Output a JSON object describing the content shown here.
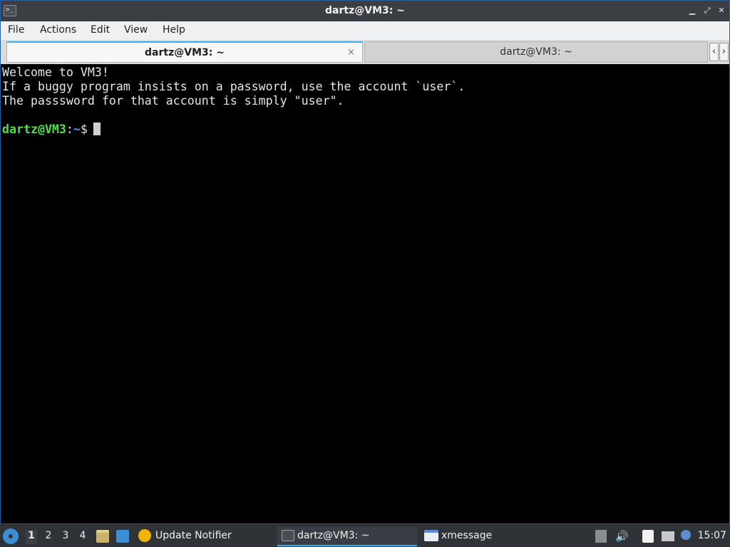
{
  "window": {
    "title": "dartz@VM3: ~",
    "icon": "terminal-icon",
    "buttons": {
      "minimize": "▁",
      "restore": "⤢",
      "close": "✕"
    }
  },
  "menu": {
    "items": [
      "File",
      "Actions",
      "Edit",
      "View",
      "Help"
    ]
  },
  "tabs": [
    {
      "label": "dartz@VM3: ~",
      "active": true,
      "close": "×"
    },
    {
      "label": "dartz@VM3: ~",
      "active": false
    }
  ],
  "tab_scroll": {
    "left": "‹",
    "right": "›"
  },
  "terminal": {
    "lines": [
      "Welcome to VM3!",
      "If a buggy program insists on a password, use the account `user`.",
      "The passsword for that account is simply \"user\"."
    ],
    "prompt": {
      "user_host": "dartz@VM3",
      "separator": ":",
      "path": "~",
      "symbol": "$"
    },
    "colors": {
      "background": "#000000",
      "text": "#e5e5e5",
      "user": "#4fe04a",
      "path": "#6e8ef5"
    }
  },
  "taskbar": {
    "start_icon": "kde-start-icon",
    "desktops": [
      "1",
      "2",
      "3",
      "4"
    ],
    "current_desktop": "1",
    "launchers": [
      "file-manager-icon",
      "show-desktop-icon"
    ],
    "tasks": [
      {
        "label": "Update Notifier",
        "icon": "update-notifier-icon",
        "active": false
      },
      {
        "label": "dartz@VM3: ~",
        "icon": "terminal-icon",
        "active": true
      },
      {
        "label": "xmessage",
        "icon": "window-icon",
        "active": false
      }
    ],
    "tray": [
      "tray-expand-icon",
      "volume-icon",
      "clipboard-icon",
      "network-icon",
      "notifications-icon"
    ],
    "clock": "15:07"
  },
  "accent": "#3daee9"
}
